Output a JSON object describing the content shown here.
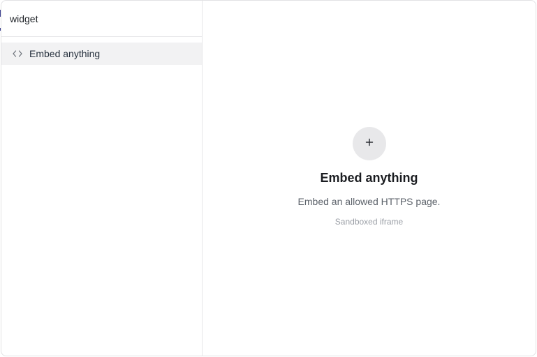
{
  "sidebar": {
    "search": {
      "value": "widget"
    },
    "items": [
      {
        "label": "Embed anything",
        "icon": "code-brackets-icon"
      }
    ]
  },
  "main": {
    "add_icon": "plus-icon",
    "title": "Embed anything",
    "subtitle": "Embed an allowed HTTPS page.",
    "hint": "Sandboxed iframe"
  },
  "colors": {
    "selected_item_bg": "#f2f2f3",
    "add_button_bg": "#e8e8ea",
    "title_text": "#1b1d21",
    "muted_text": "#9a9ea5"
  }
}
